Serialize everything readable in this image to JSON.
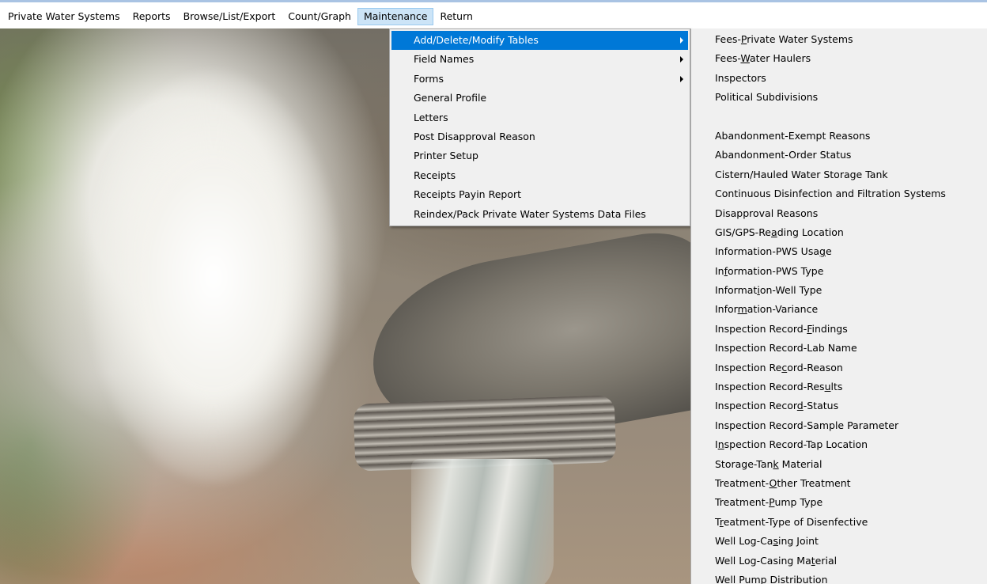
{
  "menubar": {
    "items": [
      {
        "label": "Private Water Systems"
      },
      {
        "label": "Reports"
      },
      {
        "label": "Browse/List/Export"
      },
      {
        "label": "Count/Graph"
      },
      {
        "label": "Maintenance"
      },
      {
        "label": "Return"
      }
    ],
    "active": "Maintenance"
  },
  "maintenance_menu": {
    "items": [
      {
        "label": "Add/Delete/Modify Tables",
        "has_submenu": true,
        "highlighted": true
      },
      {
        "label": "Field Names",
        "has_submenu": true
      },
      {
        "label": "Forms",
        "has_submenu": true
      },
      {
        "label": "General Profile"
      },
      {
        "label": "Letters"
      },
      {
        "label": "Post Disapproval Reason"
      },
      {
        "label": "Printer Setup"
      },
      {
        "label": "Receipts"
      },
      {
        "label": "Receipts Payin Report"
      },
      {
        "label": "Reindex/Pack Private Water Systems Data Files"
      }
    ]
  },
  "tables_submenu": {
    "group1": [
      {
        "before": "Fees-",
        "key": "P",
        "after": "rivate Water Systems"
      },
      {
        "before": "Fees-",
        "key": "W",
        "after": "ater Haulers"
      },
      {
        "before": "Inspectors",
        "key": "",
        "after": ""
      },
      {
        "before": "Political Subdivisions",
        "key": "",
        "after": ""
      }
    ],
    "group2": [
      {
        "before": "Abandonment-Exempt Reasons",
        "key": "",
        "after": ""
      },
      {
        "before": "Abandonment-Order Status",
        "key": "",
        "after": ""
      },
      {
        "before": "Cistern/Hauled Water Storage Tank",
        "key": "",
        "after": ""
      },
      {
        "before": "Continuous Disinfection and Filtration Systems",
        "key": "",
        "after": ""
      },
      {
        "before": "Disapproval Reasons",
        "key": "",
        "after": ""
      },
      {
        "before": "GIS/GPS-Re",
        "key": "a",
        "after": "ding Location"
      },
      {
        "before": "Information-PWS Usa",
        "key": "g",
        "after": "e"
      },
      {
        "before": "In",
        "key": "f",
        "after": "ormation-PWS Type"
      },
      {
        "before": "Informat",
        "key": "i",
        "after": "on-Well Type"
      },
      {
        "before": "Infor",
        "key": "m",
        "after": "ation-Variance"
      },
      {
        "before": "Inspection Record-",
        "key": "F",
        "after": "indings"
      },
      {
        "before": "Inspection Record-Lab Name",
        "key": "",
        "after": ""
      },
      {
        "before": "Inspection Re",
        "key": "c",
        "after": "ord-Reason"
      },
      {
        "before": "Inspection Record-Res",
        "key": "u",
        "after": "lts"
      },
      {
        "before": "Inspection Recor",
        "key": "d",
        "after": "-Status"
      },
      {
        "before": "Inspection Record-Sample Parameter",
        "key": "",
        "after": ""
      },
      {
        "before": "I",
        "key": "n",
        "after": "spection Record-Tap Location"
      },
      {
        "before": "Storage-Tan",
        "key": "k",
        "after": " Material"
      },
      {
        "before": "Treatment-",
        "key": "O",
        "after": "ther Treatment"
      },
      {
        "before": "Treatment-",
        "key": "P",
        "after": "ump Type"
      },
      {
        "before": "T",
        "key": "r",
        "after": "eatment-Type of Disenfective"
      },
      {
        "before": "Well Log-Ca",
        "key": "s",
        "after": "ing Joint"
      },
      {
        "before": "Well Log-Casing Ma",
        "key": "t",
        "after": "erial"
      },
      {
        "before": "Well Pump Distribution",
        "key": "",
        "after": ""
      }
    ]
  }
}
